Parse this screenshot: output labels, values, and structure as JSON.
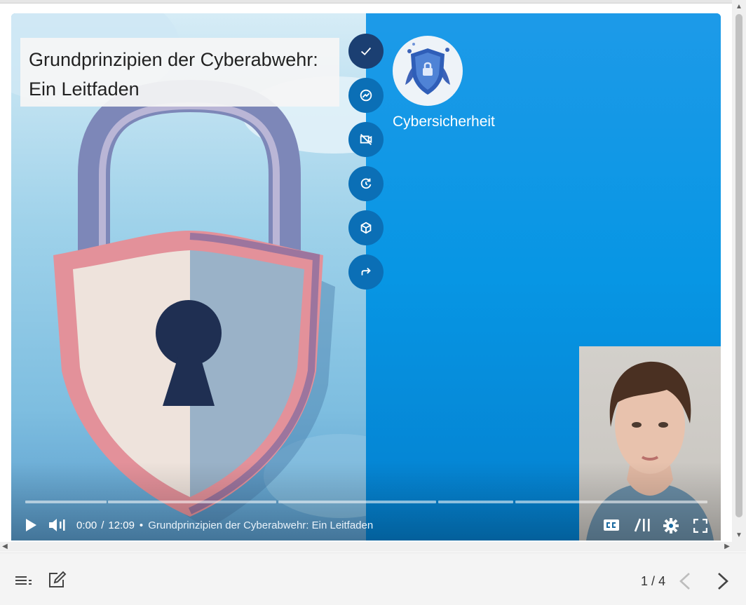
{
  "video": {
    "title_line1": "Grundprinzipien der Cyberabwehr:",
    "title_line2": "Ein Leitfaden",
    "topic_label": "Cybersicherheit",
    "current_time": "0:00",
    "time_separator": "/",
    "duration": "12:09",
    "title_separator": "•",
    "playing_title": "Grundprinzipien der Cyberabwehr: Ein Leitfaden",
    "progress_fraction": 0
  },
  "side_actions": [
    {
      "icon": "check-icon",
      "state": "completed"
    },
    {
      "icon": "trend-icon"
    },
    {
      "icon": "camera-off-icon"
    },
    {
      "icon": "history-icon"
    },
    {
      "icon": "cube-icon"
    },
    {
      "icon": "share-icon"
    }
  ],
  "controls": [
    "play-icon",
    "volume-icon",
    "captions-icon",
    "chapters-icon",
    "settings-icon",
    "fullscreen-icon"
  ],
  "pager": {
    "current": "1",
    "separator": "/",
    "total": "4"
  },
  "colors": {
    "accent": "#0796e4",
    "button": "#0b6fb6",
    "completed": "#1b3f72"
  }
}
